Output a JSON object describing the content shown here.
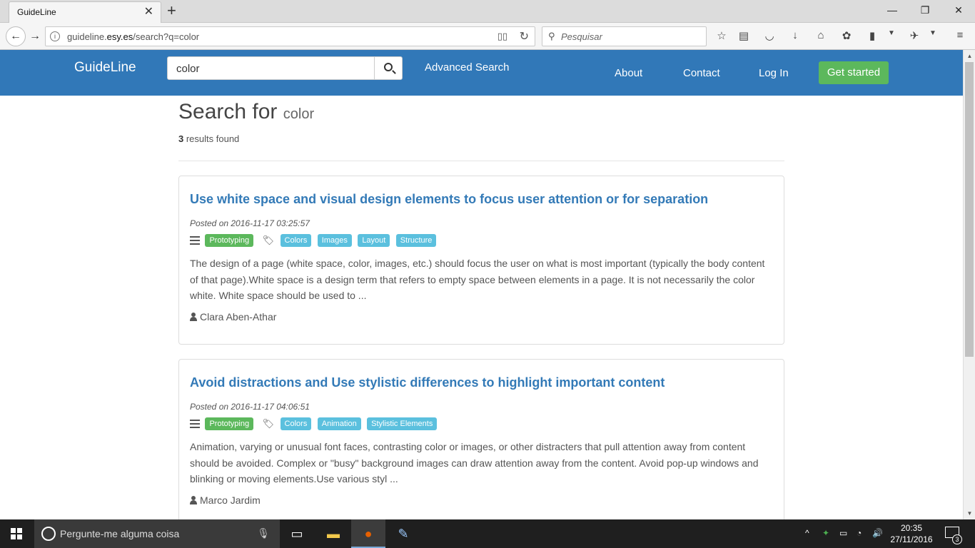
{
  "browser": {
    "tab_title": "GuideLine",
    "tab_close": "✕",
    "new_tab": "+",
    "url_prefix": "guideline.",
    "url_domain": "esy.es",
    "url_path": "/search?q=color",
    "search_placeholder": "Pesquisar",
    "window_controls": {
      "minimize": "—",
      "restore": "❐",
      "close": "✕"
    }
  },
  "site": {
    "brand": "GuideLine",
    "search_value": "color",
    "advanced_search": "Advanced Search",
    "nav": {
      "about": "About",
      "contact": "Contact",
      "login": "Log In",
      "get_started": "Get started"
    },
    "colors": {
      "header": "#3178b8",
      "success": "#5cb85c",
      "info": "#5bc0de",
      "link": "#337ab7"
    }
  },
  "results": {
    "heading": "Search for",
    "query": "color",
    "count": "3",
    "count_suffix": " results found",
    "items": [
      {
        "title": "Use white space and visual design elements to focus user attention or for separation",
        "posted": "Posted on 2016-11-17 03:25:57",
        "category": "Prototyping",
        "tags": [
          "Colors",
          "Images",
          "Layout",
          "Structure"
        ],
        "description": "The design of a page (white space, color, images, etc.) should focus the user on what is most important (typically the body content of that page).White space is a design term that refers to empty space between elements in a page. It is not necessarily the color white. White space should be used to ...",
        "author": "Clara Aben-Athar"
      },
      {
        "title": "Avoid distractions and Use stylistic differences to highlight important content",
        "posted": "Posted on 2016-11-17 04:06:51",
        "category": "Prototyping",
        "tags": [
          "Colors",
          "Animation",
          "Stylistic Elements"
        ],
        "description": "Animation, varying or unusual font faces, contrasting color or images, or other distracters that pull attention away from content should be avoided. Complex or \"busy\" background images can draw attention away from the content. Avoid pop-up windows and blinking or moving elements.Use various styl ...",
        "author": "Marco Jardim"
      }
    ]
  },
  "taskbar": {
    "cortana_placeholder": "Pergunte-me alguma coisa",
    "time": "20:35",
    "date": "27/11/2016",
    "notification_count": "3"
  }
}
